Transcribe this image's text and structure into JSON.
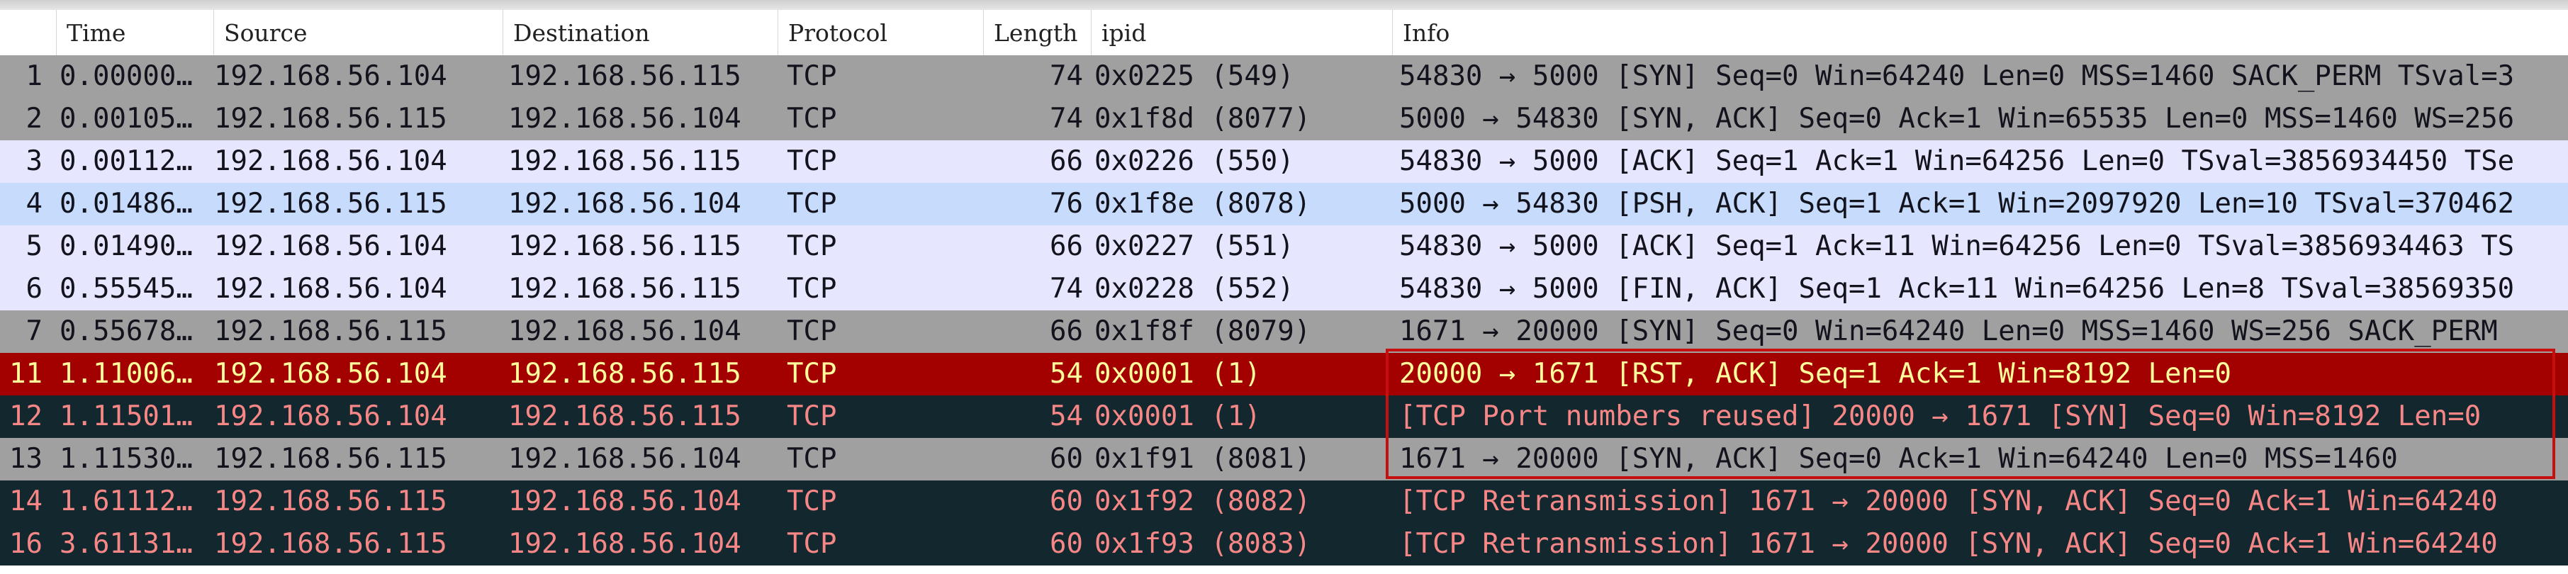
{
  "columns": [
    {
      "key": "no",
      "label": ""
    },
    {
      "key": "time",
      "label": "Time"
    },
    {
      "key": "source",
      "label": "Source"
    },
    {
      "key": "destination",
      "label": "Destination"
    },
    {
      "key": "protocol",
      "label": "Protocol"
    },
    {
      "key": "length",
      "label": "Length"
    },
    {
      "key": "ipid",
      "label": "ipid"
    },
    {
      "key": "info",
      "label": "Info"
    }
  ],
  "row_styles": {
    "gray": {
      "bg": "#a0a0a0",
      "fg": "#12131c"
    },
    "lavender": {
      "bg": "#e7e6ff",
      "fg": "#12131c"
    },
    "blue": {
      "bg": "#c7dcfd",
      "fg": "#12131c"
    },
    "red": {
      "bg": "#a30000",
      "fg": "#fffc9c"
    },
    "dark": {
      "bg": "#12272e",
      "fg": "#f78787"
    }
  },
  "packets": [
    {
      "no": "1",
      "time": "0.00000…",
      "source": "192.168.56.104",
      "destination": "192.168.56.115",
      "protocol": "TCP",
      "length": "74",
      "ipid": "0x0225 (549)",
      "info": "54830 → 5000 [SYN] Seq=0 Win=64240 Len=0 MSS=1460 SACK_PERM TSval=3",
      "style": "gray"
    },
    {
      "no": "2",
      "time": "0.00105…",
      "source": "192.168.56.115",
      "destination": "192.168.56.104",
      "protocol": "TCP",
      "length": "74",
      "ipid": "0x1f8d (8077)",
      "info": "5000 → 54830 [SYN, ACK] Seq=0 Ack=1 Win=65535 Len=0 MSS=1460 WS=256",
      "style": "gray"
    },
    {
      "no": "3",
      "time": "0.00112…",
      "source": "192.168.56.104",
      "destination": "192.168.56.115",
      "protocol": "TCP",
      "length": "66",
      "ipid": "0x0226 (550)",
      "info": "54830 → 5000 [ACK] Seq=1 Ack=1 Win=64256 Len=0 TSval=3856934450 TSe",
      "style": "lavender"
    },
    {
      "no": "4",
      "time": "0.01486…",
      "source": "192.168.56.115",
      "destination": "192.168.56.104",
      "protocol": "TCP",
      "length": "76",
      "ipid": "0x1f8e (8078)",
      "info": "5000 → 54830 [PSH, ACK] Seq=1 Ack=1 Win=2097920 Len=10 TSval=370462",
      "style": "blue"
    },
    {
      "no": "5",
      "time": "0.01490…",
      "source": "192.168.56.104",
      "destination": "192.168.56.115",
      "protocol": "TCP",
      "length": "66",
      "ipid": "0x0227 (551)",
      "info": "54830 → 5000 [ACK] Seq=1 Ack=11 Win=64256 Len=0 TSval=3856934463 TS",
      "style": "lavender"
    },
    {
      "no": "6",
      "time": "0.55545…",
      "source": "192.168.56.104",
      "destination": "192.168.56.115",
      "protocol": "TCP",
      "length": "74",
      "ipid": "0x0228 (552)",
      "info": "54830 → 5000 [FIN, ACK] Seq=1 Ack=11 Win=64256 Len=8 TSval=38569350",
      "style": "lavender"
    },
    {
      "no": "7",
      "time": "0.55678…",
      "source": "192.168.56.115",
      "destination": "192.168.56.104",
      "protocol": "TCP",
      "length": "66",
      "ipid": "0x1f8f (8079)",
      "info": "1671 → 20000 [SYN] Seq=0 Win=64240 Len=0 MSS=1460 WS=256 SACK_PERM",
      "style": "gray"
    },
    {
      "no": "11",
      "time": "1.11006…",
      "source": "192.168.56.104",
      "destination": "192.168.56.115",
      "protocol": "TCP",
      "length": "54",
      "ipid": "0x0001 (1)",
      "info": "20000 → 1671 [RST, ACK] Seq=1 Ack=1 Win=8192 Len=0",
      "style": "red"
    },
    {
      "no": "12",
      "time": "1.11501…",
      "source": "192.168.56.104",
      "destination": "192.168.56.115",
      "protocol": "TCP",
      "length": "54",
      "ipid": "0x0001 (1)",
      "info": "[TCP Port numbers reused] 20000 → 1671 [SYN] Seq=0 Win=8192 Len=0",
      "style": "dark"
    },
    {
      "no": "13",
      "time": "1.11530…",
      "source": "192.168.56.115",
      "destination": "192.168.56.104",
      "protocol": "TCP",
      "length": "60",
      "ipid": "0x1f91 (8081)",
      "info": "1671 → 20000 [SYN, ACK] Seq=0 Ack=1 Win=64240 Len=0 MSS=1460",
      "style": "gray"
    },
    {
      "no": "14",
      "time": "1.61112…",
      "source": "192.168.56.115",
      "destination": "192.168.56.104",
      "protocol": "TCP",
      "length": "60",
      "ipid": "0x1f92 (8082)",
      "info": "[TCP Retransmission] 1671 → 20000 [SYN, ACK] Seq=0 Ack=1 Win=64240",
      "style": "dark"
    },
    {
      "no": "16",
      "time": "3.61131…",
      "source": "192.168.56.115",
      "destination": "192.168.56.104",
      "protocol": "TCP",
      "length": "60",
      "ipid": "0x1f93 (8083)",
      "info": "[TCP Retransmission] 1671 → 20000 [SYN, ACK] Seq=0 Ack=1 Win=64240",
      "style": "dark"
    }
  ],
  "highlight_color": "#c80f0f"
}
